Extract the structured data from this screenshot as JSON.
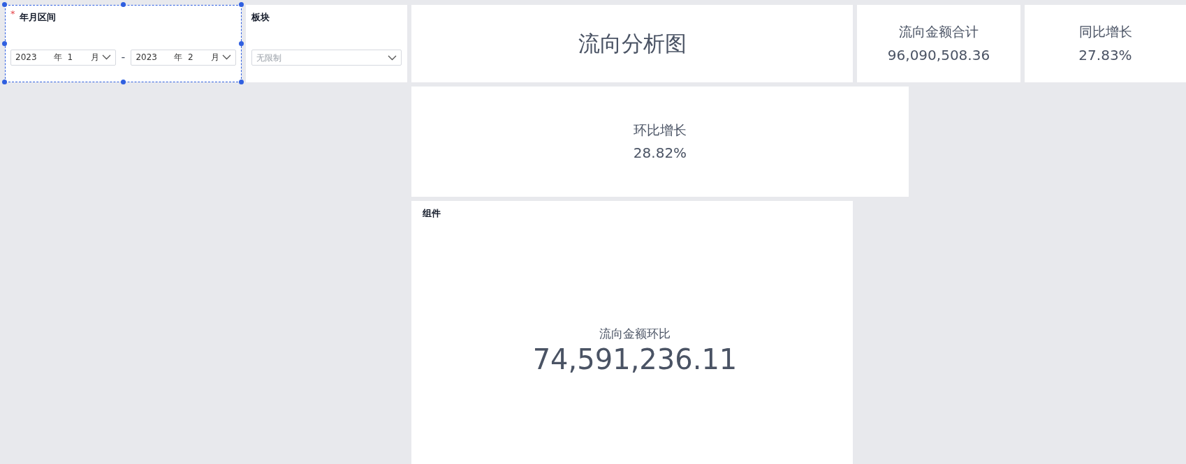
{
  "widgets": [
    {
      "kind": "date_range",
      "label": "年月区间",
      "required_mark": "*",
      "selected": true,
      "start": {
        "year": "2023",
        "year_unit": "年",
        "month": "1",
        "month_unit": "月"
      },
      "separator": "-",
      "end": {
        "year": "2023",
        "year_unit": "年",
        "month": "2",
        "month_unit": "月"
      }
    },
    {
      "kind": "select",
      "label": "板块",
      "placeholder": "无限制",
      "selected": false
    },
    {
      "kind": "title",
      "text": "流向分析图",
      "selected": false
    },
    {
      "kind": "metric",
      "label": "流向金额合计",
      "value": "96,090,508.36",
      "selected": false
    },
    {
      "kind": "metric",
      "label": "同比增长",
      "value": "27.83%",
      "selected": false
    },
    {
      "kind": "metric",
      "label": "环比增长",
      "value": "28.82%",
      "selected": false
    },
    {
      "kind": "big_metric",
      "title": "组件",
      "label": "流向金额环比",
      "value": "74,591,236.11",
      "selected": false
    }
  ]
}
